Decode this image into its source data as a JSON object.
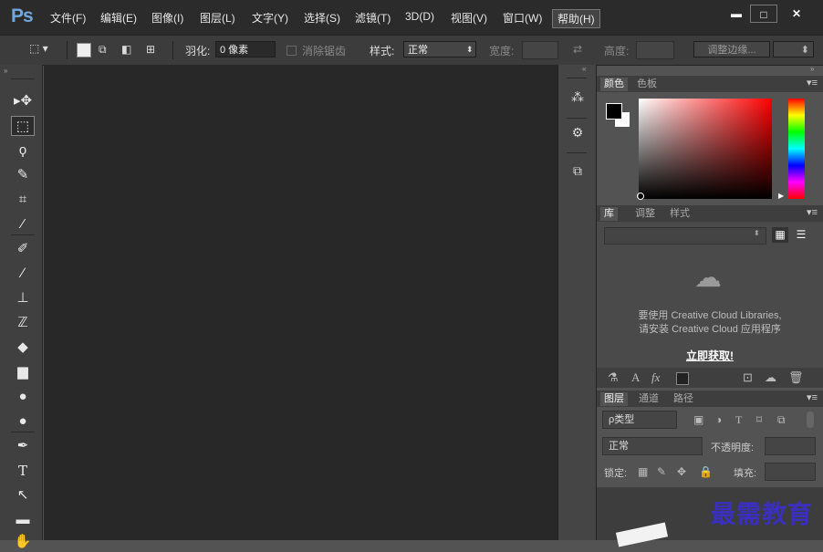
{
  "app": {
    "logo": "Ps"
  },
  "menu": [
    "文件(F)",
    "编辑(E)",
    "图像(I)",
    "图层(L)",
    "文字(Y)",
    "选择(S)",
    "滤镜(T)",
    "3D(D)",
    "视图(V)",
    "窗口(W)",
    "帮助(H)"
  ],
  "window_controls": {
    "minimize": "▬",
    "maximize": "□",
    "close": "✕"
  },
  "options": {
    "feather_label": "羽化:",
    "feather_value": "0 像素",
    "antialias_label": "消除锯齿",
    "style_label": "样式:",
    "style_value": "正常",
    "width_label": "宽度:",
    "height_label": "高度:",
    "refine_edge": "调整边缘..."
  },
  "tools": [
    "move-tool",
    "rect-marquee-tool",
    "lasso-tool",
    "quick-selection-tool",
    "crop-tool",
    "eyedropper-tool",
    "healing-brush-tool",
    "brush-tool",
    "clone-stamp-tool",
    "history-brush-tool",
    "eraser-tool",
    "gradient-tool",
    "blur-tool",
    "dodge-tool",
    "pen-tool",
    "type-tool",
    "path-selection-tool",
    "rectangle-tool"
  ],
  "color_panel": {
    "tabs": [
      "颜色",
      "色板"
    ],
    "foreground": "#000000",
    "background": "#ffffff"
  },
  "library_panel": {
    "tabs": [
      "库",
      "调整",
      "样式"
    ],
    "message_line1": "要使用 Creative Cloud Libraries,",
    "message_line2": "请安装 Creative Cloud 应用程序",
    "link": "立即获取!"
  },
  "layers_panel": {
    "tabs": [
      "图层",
      "通道",
      "路径"
    ],
    "filter_kind": "ρ类型",
    "blend_mode": "正常",
    "opacity_label": "不透明度:",
    "lock_label": "锁定:",
    "fill_label": "填充:"
  },
  "watermark": "最需教育"
}
